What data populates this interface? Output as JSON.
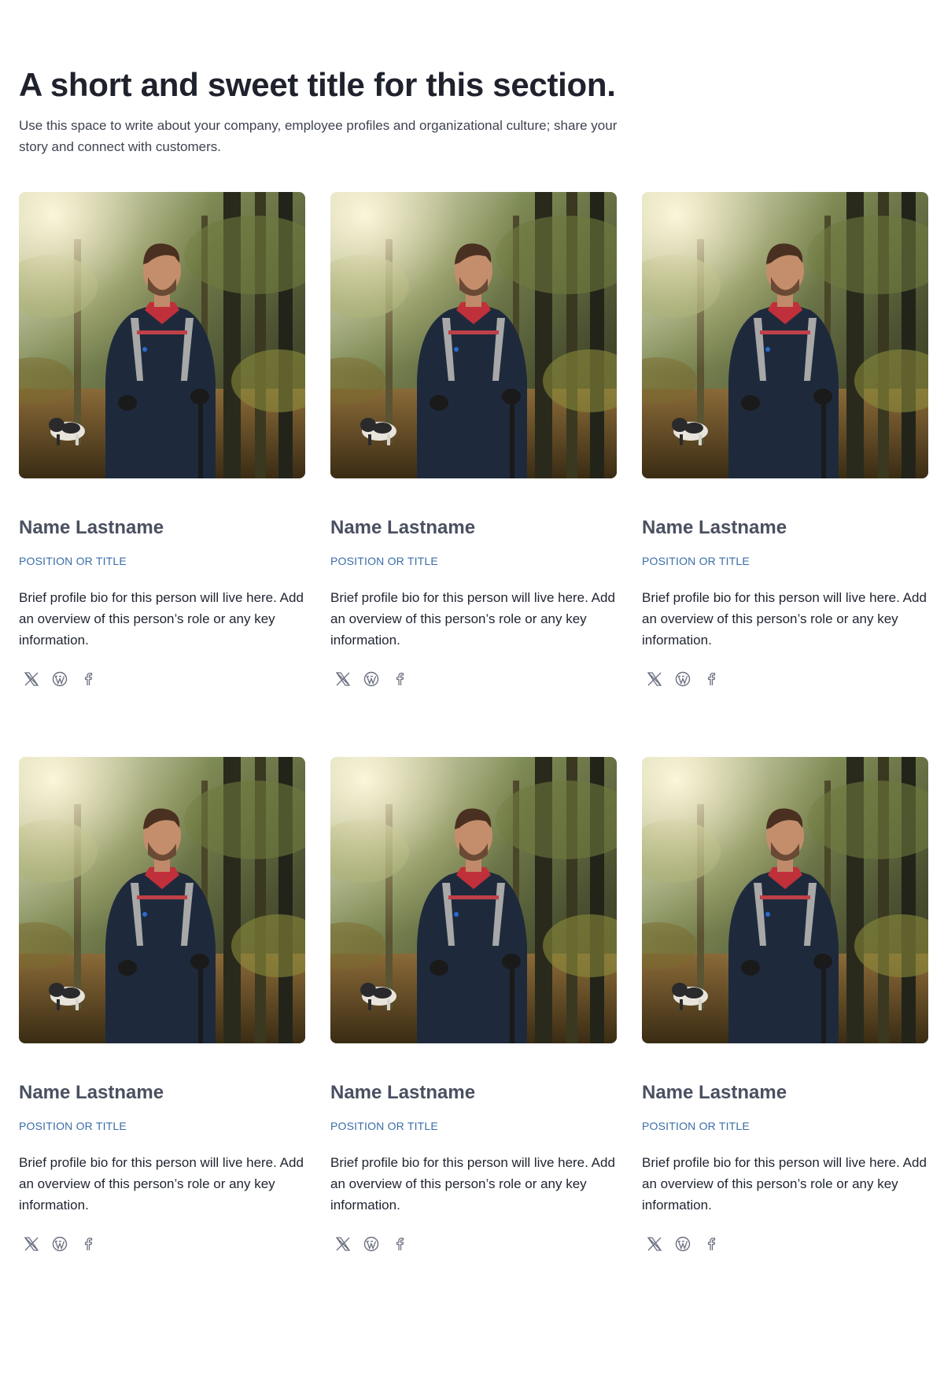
{
  "header": {
    "title": "A short and sweet title for this section.",
    "subtitle": "Use this space to write about your company, employee profiles and organizational culture; share your story and connect with customers."
  },
  "colors": {
    "title": "#1f222c",
    "name": "#4a5060",
    "position": "#3a6da8",
    "icon": "#6b7080"
  },
  "profiles": [
    {
      "photo": "hiker-in-forest-photo",
      "name": "Name Lastname",
      "position": "POSITION OR TITLE",
      "bio": "Brief profile bio for this person will live here. Add an overview of this person’s role or any key information.",
      "socials": [
        "x-icon",
        "wordpress-icon",
        "facebook-icon"
      ]
    },
    {
      "photo": "hiker-in-forest-photo",
      "name": "Name Lastname",
      "position": "POSITION OR TITLE",
      "bio": "Brief profile bio for this person will live here. Add an overview of this person’s role or any key information.",
      "socials": [
        "x-icon",
        "wordpress-icon",
        "facebook-icon"
      ]
    },
    {
      "photo": "hiker-in-forest-photo",
      "name": "Name Lastname",
      "position": "POSITION OR TITLE",
      "bio": "Brief profile bio for this person will live here. Add an overview of this person’s role or any key information.",
      "socials": [
        "x-icon",
        "wordpress-icon",
        "facebook-icon"
      ]
    },
    {
      "photo": "hiker-in-forest-photo",
      "name": "Name Lastname",
      "position": "POSITION OR TITLE",
      "bio": "Brief profile bio for this person will live here. Add an overview of this person’s role or any key information.",
      "socials": [
        "x-icon",
        "wordpress-icon",
        "facebook-icon"
      ]
    },
    {
      "photo": "hiker-in-forest-photo",
      "name": "Name Lastname",
      "position": "POSITION OR TITLE",
      "bio": "Brief profile bio for this person will live here. Add an overview of this person’s role or any key information.",
      "socials": [
        "x-icon",
        "wordpress-icon",
        "facebook-icon"
      ]
    },
    {
      "photo": "hiker-in-forest-photo",
      "name": "Name Lastname",
      "position": "POSITION OR TITLE",
      "bio": "Brief profile bio for this person will live here. Add an overview of this person’s role or any key information.",
      "socials": [
        "x-icon",
        "wordpress-icon",
        "facebook-icon"
      ]
    }
  ]
}
